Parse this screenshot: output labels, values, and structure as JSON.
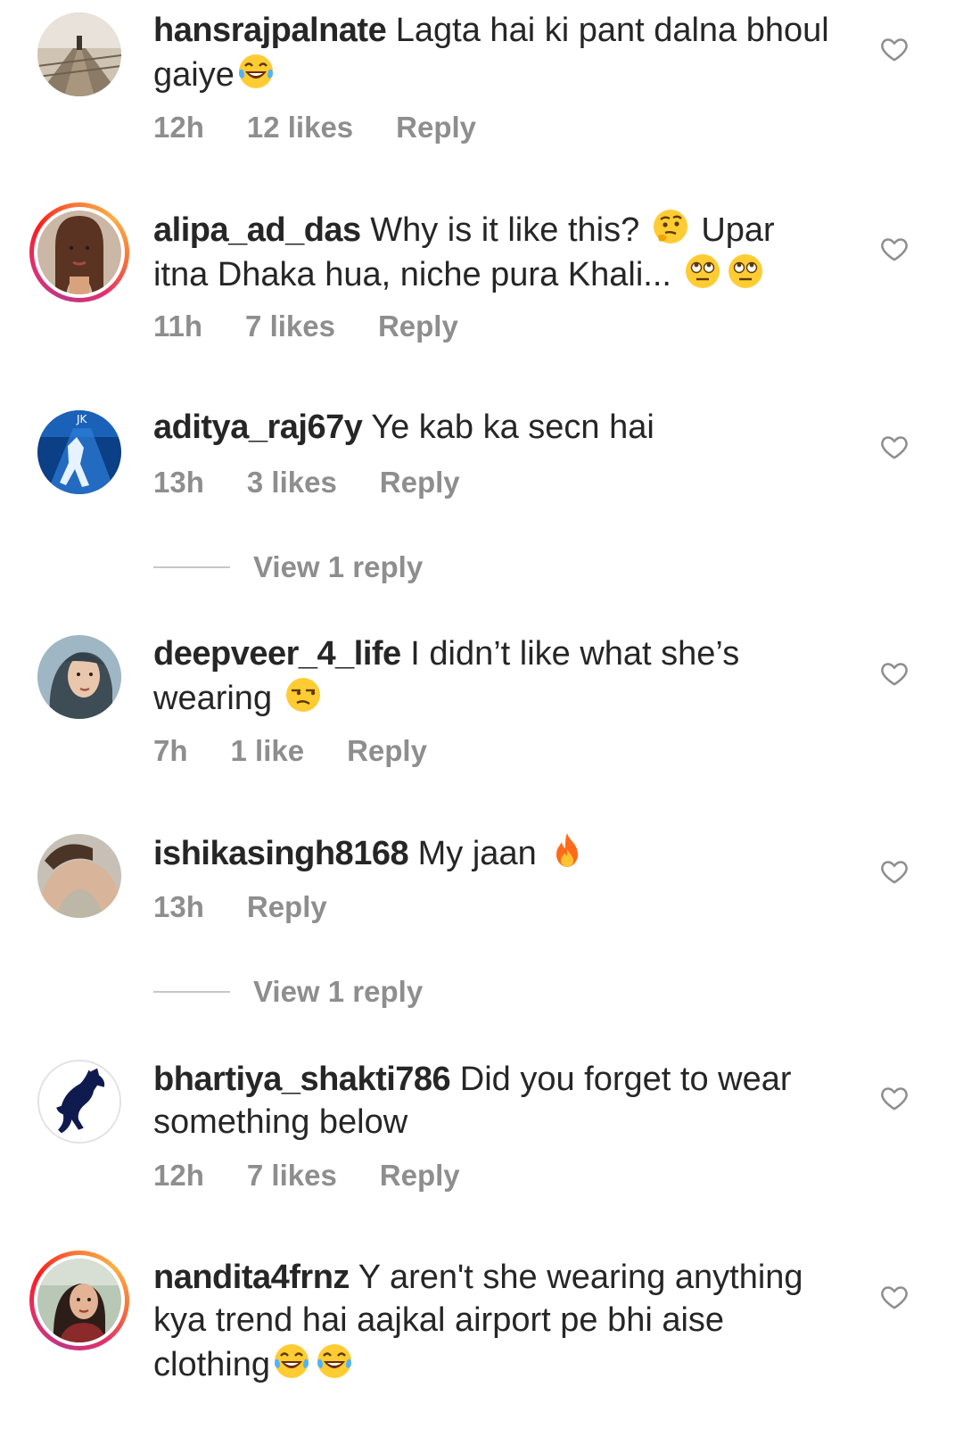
{
  "comments": [
    {
      "username": "hansrajpalnate",
      "text": "Lagta hai ki pant dalna bhoul gaiye",
      "emoji": [
        "tears-of-joy"
      ],
      "time": "12h",
      "likes": "12 likes",
      "reply": "Reply"
    },
    {
      "username": "alipa_ad_das",
      "text": "Why is it like this?",
      "emoji": [
        "thinking"
      ],
      "text2": "Upar itna Dhaka hua, niche pura Khali...",
      "emoji2": [
        "rolling-eyes",
        "rolling-eyes"
      ],
      "time": "11h",
      "likes": "7 likes",
      "reply": "Reply"
    },
    {
      "username": "aditya_raj67y",
      "text": "Ye kab ka secn hai",
      "time": "13h",
      "likes": "3 likes",
      "reply": "Reply",
      "view_replies": "View 1 reply"
    },
    {
      "username": "deepveer_4_life",
      "text": "I didn’t like what she’s wearing",
      "emoji": [
        "unamused"
      ],
      "time": "7h",
      "likes": "1 like",
      "reply": "Reply"
    },
    {
      "username": "ishikasingh8168",
      "text": "My jaan",
      "emoji": [
        "fire"
      ],
      "time": "13h",
      "reply": "Reply",
      "view_replies": "View 1 reply"
    },
    {
      "username": "bhartiya_shakti786",
      "text": "Did you forget to wear something below",
      "time": "12h",
      "likes": "7 likes",
      "reply": "Reply"
    },
    {
      "username": "nandita4frnz",
      "text": "Y aren't she wearing anything kya trend hai aajkal airport pe bhi aise clothing",
      "emoji": [
        "tears-of-joy",
        "tears-of-joy"
      ]
    }
  ],
  "icons": {
    "like": "heart-outline-icon",
    "avatar_ring": "story-ring"
  },
  "colors": {
    "text": "#262626",
    "meta": "#8e8e8e",
    "heart": "#8e8e8e",
    "divider": "#c7c7c7",
    "story_ring_start": "#c13584",
    "story_ring_end": "#fcaf45"
  }
}
